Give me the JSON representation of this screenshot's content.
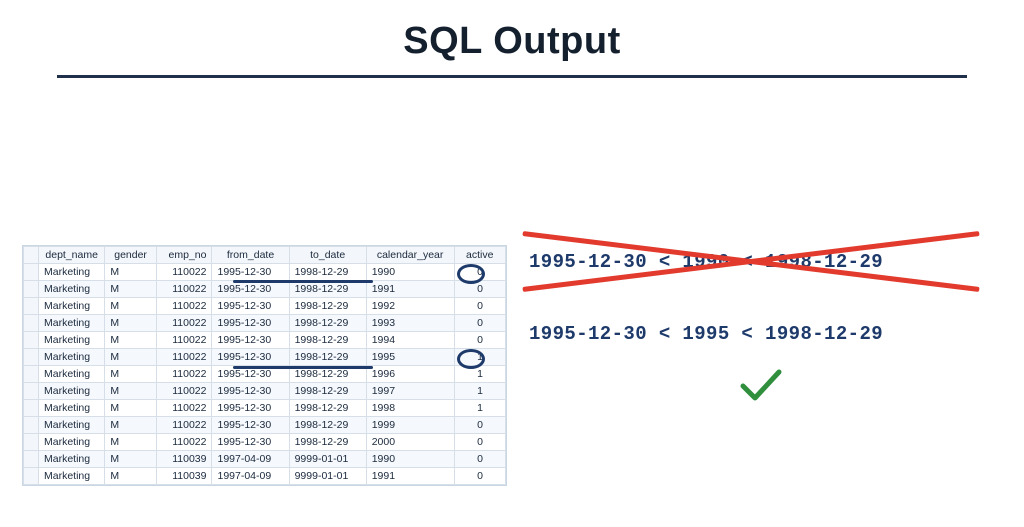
{
  "title": "SQL Output",
  "table": {
    "headers": [
      "",
      "dept_name",
      "gender",
      "emp_no",
      "from_date",
      "to_date",
      "calendar_year",
      "active"
    ],
    "rows": [
      [
        "",
        "Marketing",
        "M",
        "110022",
        "1995-12-30",
        "1998-12-29",
        "1990",
        "0"
      ],
      [
        "",
        "Marketing",
        "M",
        "110022",
        "1995-12-30",
        "1998-12-29",
        "1991",
        "0"
      ],
      [
        "",
        "Marketing",
        "M",
        "110022",
        "1995-12-30",
        "1998-12-29",
        "1992",
        "0"
      ],
      [
        "",
        "Marketing",
        "M",
        "110022",
        "1995-12-30",
        "1998-12-29",
        "1993",
        "0"
      ],
      [
        "",
        "Marketing",
        "M",
        "110022",
        "1995-12-30",
        "1998-12-29",
        "1994",
        "0"
      ],
      [
        "",
        "Marketing",
        "M",
        "110022",
        "1995-12-30",
        "1998-12-29",
        "1995",
        "1"
      ],
      [
        "",
        "Marketing",
        "M",
        "110022",
        "1995-12-30",
        "1998-12-29",
        "1996",
        "1"
      ],
      [
        "",
        "Marketing",
        "M",
        "110022",
        "1995-12-30",
        "1998-12-29",
        "1997",
        "1"
      ],
      [
        "",
        "Marketing",
        "M",
        "110022",
        "1995-12-30",
        "1998-12-29",
        "1998",
        "1"
      ],
      [
        "",
        "Marketing",
        "M",
        "110022",
        "1995-12-30",
        "1998-12-29",
        "1999",
        "0"
      ],
      [
        "",
        "Marketing",
        "M",
        "110022",
        "1995-12-30",
        "1998-12-29",
        "2000",
        "0"
      ],
      [
        "",
        "Marketing",
        "M",
        "110039",
        "1997-04-09",
        "9999-01-01",
        "1990",
        "0"
      ],
      [
        "",
        "Marketing",
        "M",
        "110039",
        "1997-04-09",
        "9999-01-01",
        "1991",
        "0"
      ]
    ]
  },
  "expr1": "1995-12-30  <  1990  <  1998-12-29",
  "expr2": "1995-12-30  <  1995  <  1998-12-29"
}
